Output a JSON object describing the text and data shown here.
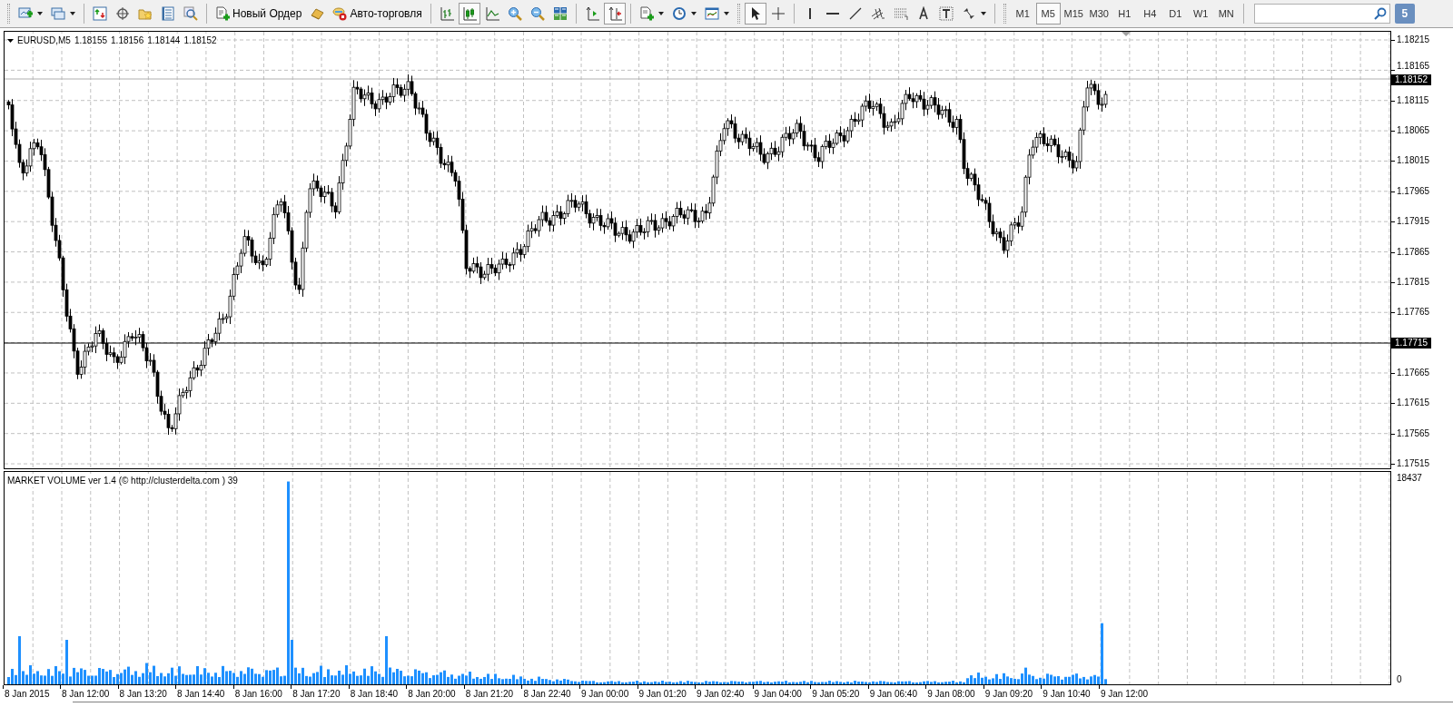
{
  "toolbar": {
    "order_button": "Новый Ордер",
    "autotrade_button": "Авто-торговля",
    "chart_types": [
      {
        "kind": "bars",
        "selected": false
      },
      {
        "kind": "candles",
        "selected": true
      },
      {
        "kind": "line",
        "selected": false
      }
    ],
    "chart_options": [
      {
        "kind": "autoscroll",
        "selected": false
      },
      {
        "kind": "shift",
        "selected": true
      }
    ],
    "tools": [
      {
        "kind": "cursor",
        "selected": true
      },
      {
        "kind": "crosshair",
        "selected": false
      }
    ],
    "timeframes": [
      {
        "label": "M1",
        "selected": false
      },
      {
        "label": "M5",
        "selected": true
      },
      {
        "label": "M15",
        "selected": false
      },
      {
        "label": "M30",
        "selected": false
      },
      {
        "label": "H1",
        "selected": false
      },
      {
        "label": "H4",
        "selected": false
      },
      {
        "label": "D1",
        "selected": false
      },
      {
        "label": "W1",
        "selected": false
      },
      {
        "label": "MN",
        "selected": false
      }
    ],
    "messages_badge": "5"
  },
  "chart": {
    "symbol": "EURUSD,M5",
    "ohlc": [
      "1.18155",
      "1.18156",
      "1.18144",
      "1.18152"
    ],
    "price_ticks": [
      "1.18215",
      "1.18165",
      "1.18115",
      "1.18065",
      "1.18015",
      "1.17965",
      "1.17915",
      "1.17865",
      "1.17815",
      "1.17765",
      "1.17665",
      "1.17615",
      "1.17565",
      "1.17515"
    ],
    "bid_label": "1.18152",
    "line_label": "1.17715"
  },
  "volume_indicator": {
    "title": "MARKET VOLUME ver 1.4 (© http://clusterdelta.com ) 39",
    "max_label": "18437",
    "min_label": "0"
  },
  "time_axis": [
    "8 Jan 2015",
    "8 Jan 12:00",
    "8 Jan 13:20",
    "8 Jan 14:40",
    "8 Jan 16:00",
    "8 Jan 17:20",
    "8 Jan 18:40",
    "8 Jan 20:00",
    "8 Jan 21:20",
    "8 Jan 22:40",
    "9 Jan 00:00",
    "9 Jan 01:20",
    "9 Jan 02:40",
    "9 Jan 04:00",
    "9 Jan 05:20",
    "9 Jan 06:40",
    "9 Jan 08:00",
    "9 Jan 09:20",
    "9 Jan 10:40",
    "9 Jan 12:00"
  ]
}
